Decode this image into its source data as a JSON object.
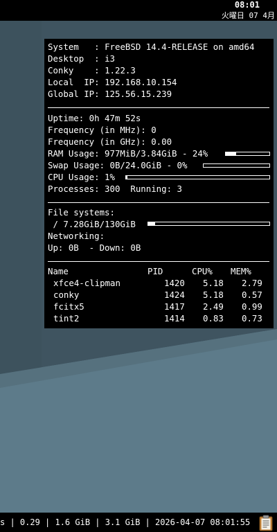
{
  "topbar": {
    "time": "08:01",
    "date": "火曜日 07 4月"
  },
  "conky": {
    "system_label": "System   :",
    "system_value": "FreeBSD 14.4-RELEASE on amd64",
    "desktop_label": "Desktop  :",
    "desktop_value": "i3",
    "conky_label": "Conky    :",
    "conky_value": "1.22.3",
    "local_ip_label": "Local  IP:",
    "local_ip_value": "192.168.10.154",
    "global_ip_label": "Global IP:",
    "global_ip_value": "125.56.15.239",
    "uptime": "Uptime: 0h 47m 52s",
    "freq_mhz": "Frequency (in MHz): 0",
    "freq_ghz": "Frequency (in GHz): 0.00",
    "ram_usage": "RAM Usage: 977MiB/3.84GiB - 24%",
    "ram_percent": 24,
    "swap_usage": "Swap Usage: 0B/24.0GiB - 0%",
    "swap_percent": 0,
    "cpu_usage": "CPU Usage: 1%",
    "cpu_percent": 1,
    "processes": "Processes: 300  Running: 3",
    "fs_title": "File systems:",
    "fs_root": " / 7.28GiB/130GiB",
    "fs_percent": 5.6,
    "networking_title": "Networking:",
    "net_speed": "Up: 0B  - Down: 0B",
    "proc_headers": {
      "name": "Name",
      "pid": "PID",
      "cpu": "CPU%",
      "mem": "MEM%"
    },
    "processes_list": [
      {
        "name": "xfce4-clipman",
        "pid": "1420",
        "cpu": "5.18",
        "mem": "2.79"
      },
      {
        "name": "conky",
        "pid": "1424",
        "cpu": "5.18",
        "mem": "0.57"
      },
      {
        "name": "fcitx5",
        "pid": "1417",
        "cpu": "2.49",
        "mem": "0.99"
      },
      {
        "name": "tint2",
        "pid": "1414",
        "cpu": "0.83",
        "mem": "0.73"
      }
    ]
  },
  "statusbar": {
    "text": "s | 0.29 | 1.6 GiB | 3.1 GiB | 2026-04-07 08:01:55"
  },
  "tray": {
    "icon": "clipboard-icon"
  },
  "colors": {
    "panel_bg": "#000000",
    "text": "#ffffff",
    "wallpaper_dark": "#3b4f5a",
    "wallpaper_light": "#5b7988"
  }
}
